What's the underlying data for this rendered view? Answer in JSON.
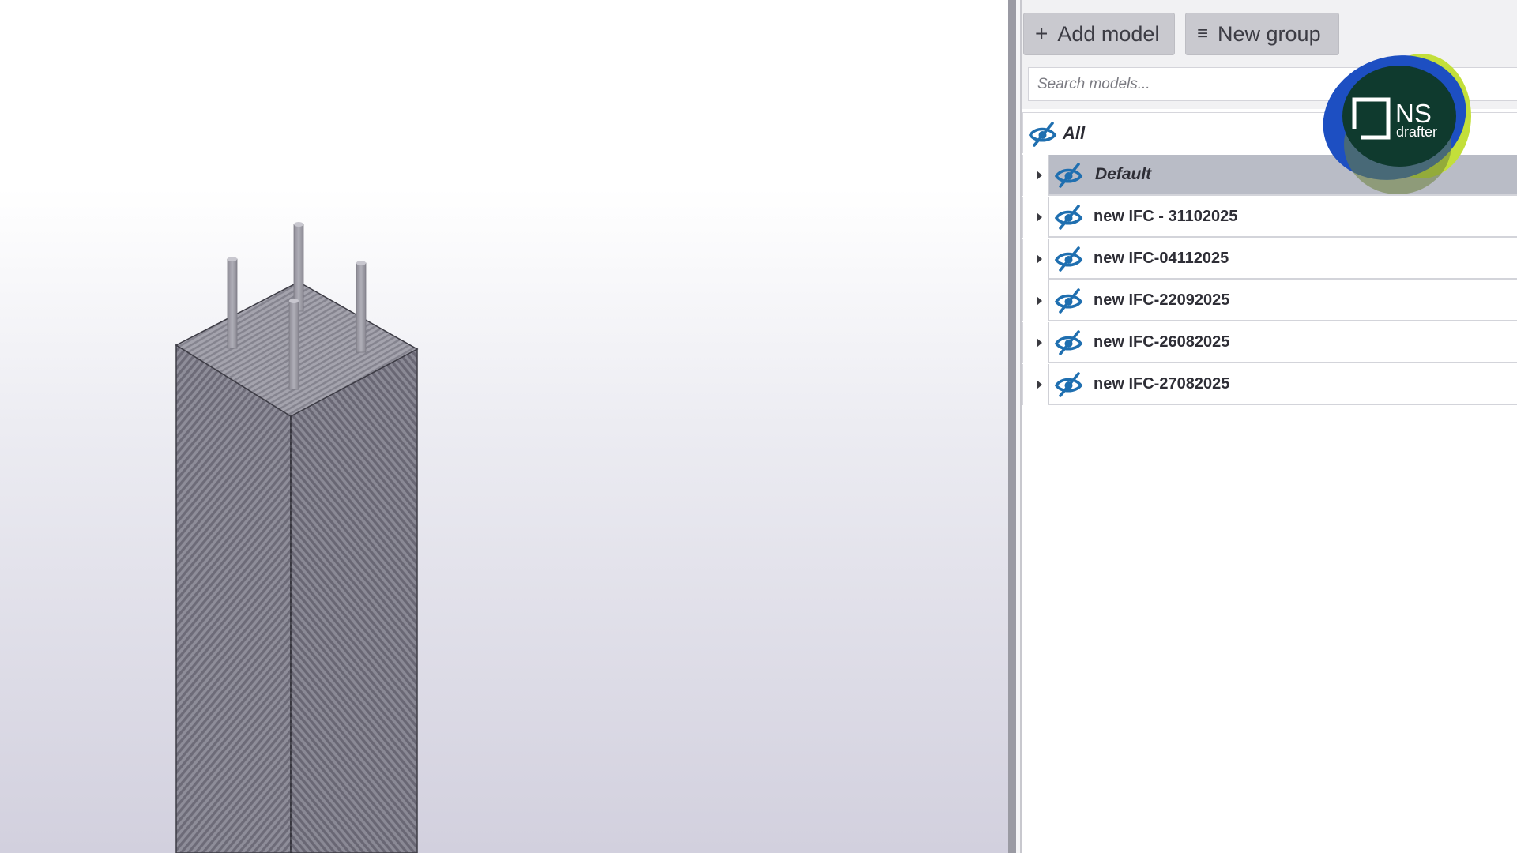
{
  "toolbar": {
    "add_model": {
      "icon": "plus-icon",
      "glyph": "+",
      "label": "Add model"
    },
    "new_group": {
      "icon": "list-icon",
      "glyph": "≡",
      "label": "New group"
    }
  },
  "search": {
    "placeholder": "Search models..."
  },
  "tree": {
    "all_label": "All",
    "items": [
      {
        "label": "Default",
        "selected": true
      },
      {
        "label": "new IFC - 31102025"
      },
      {
        "label": "new IFC-04112025"
      },
      {
        "label": "new IFC-22092025"
      },
      {
        "label": "new IFC-26082025"
      },
      {
        "label": "new IFC-27082025"
      }
    ]
  },
  "logo": {
    "text_main": "NS",
    "text_sub": "drafter"
  },
  "colors": {
    "eye_icon": "#1f6fb0",
    "selected_row": "#b9bcc6",
    "logo_dark": "#0f3a2e",
    "logo_blue": "#1d4fc2",
    "logo_lime": "#c3df3a"
  }
}
